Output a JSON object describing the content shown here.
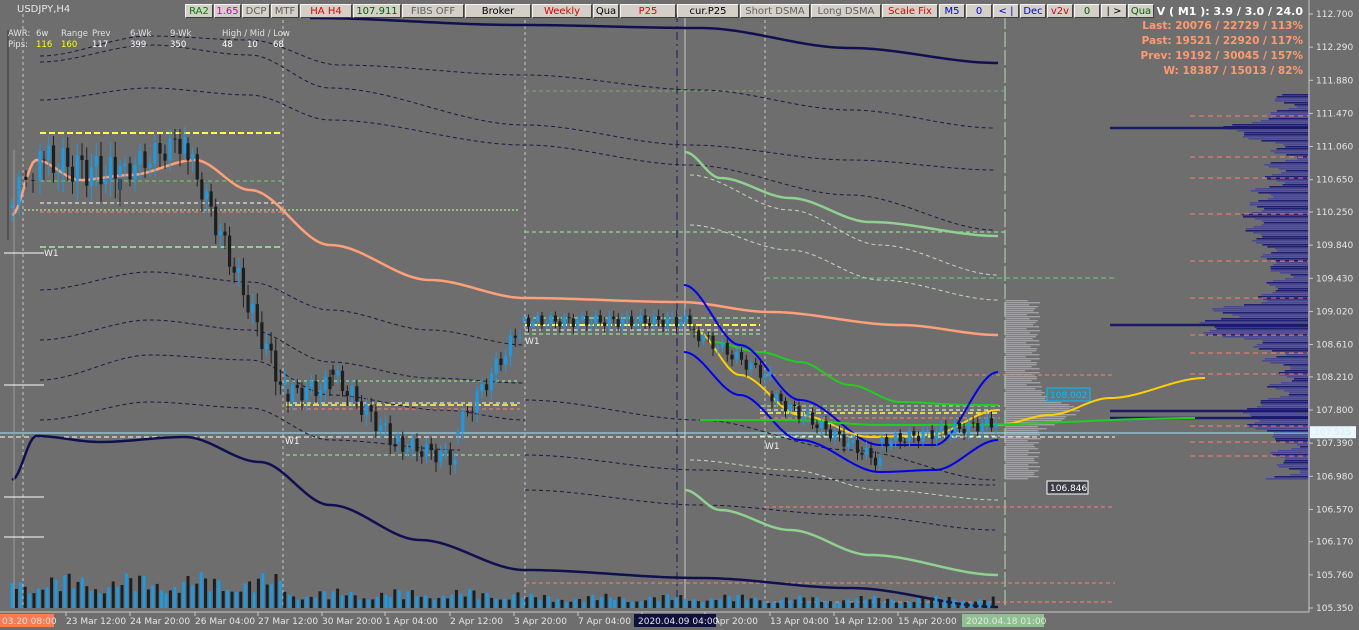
{
  "symbol": "USDJPY,H4",
  "toolbar": [
    {
      "label": "RA2",
      "color": "#008000",
      "w": 28
    },
    {
      "label": "1.65",
      "color": "#c000c0",
      "w": 27
    },
    {
      "label": "DCP",
      "color": "#606060",
      "w": 28
    },
    {
      "label": "MTF",
      "color": "#606060",
      "w": 28
    },
    {
      "label": "HA H4",
      "color": "#e00000",
      "w": 52
    },
    {
      "label": "107.911",
      "color": "#006000",
      "w": 48
    },
    {
      "label": "FIBS OFF",
      "color": "#606060",
      "w": 62
    },
    {
      "label": "Broker",
      "color": "#000000",
      "w": 66
    },
    {
      "label": "Weekly",
      "color": "#e00000",
      "w": 60
    },
    {
      "label": "Qua",
      "color": "#000000",
      "w": 26
    },
    {
      "label": "P25",
      "color": "#e00000",
      "w": 56
    },
    {
      "label": "cur.P25",
      "color": "#000000",
      "w": 62
    },
    {
      "label": "Short DSMA",
      "color": "#606060",
      "w": 70
    },
    {
      "label": "Long DSMA",
      "color": "#606060",
      "w": 70
    },
    {
      "label": "Scale Fix",
      "color": "#e00000",
      "w": 56
    },
    {
      "label": "M5",
      "color": "#0000e0",
      "w": 26
    },
    {
      "label": "0",
      "color": "#0000e0",
      "w": 26
    },
    {
      "label": "< |",
      "color": "#0000e0",
      "w": 26
    },
    {
      "label": "Dec",
      "color": "#0000e0",
      "w": 26
    },
    {
      "label": "v2v",
      "color": "#e00000",
      "w": 26
    },
    {
      "label": "0",
      "color": "#006000",
      "w": 26
    },
    {
      "label": "| >",
      "color": "#000000",
      "w": 26
    },
    {
      "label": "Qua",
      "color": "#006000",
      "w": 26
    }
  ],
  "stats": [
    {
      "text": "V ( M1 ): 3.9 / 3.0 / 24.0",
      "color": "#ffffff"
    },
    {
      "text": "Last: 20076 / 22729 / 113%",
      "color": "#ff9a70"
    },
    {
      "text": "Past: 19521 / 22920 / 117%",
      "color": "#ff9a70"
    },
    {
      "text": "Prev: 19192 / 30045 / 157%",
      "color": "#ff9a70"
    },
    {
      "text": "W: 18387 / 15013 / 82%",
      "color": "#ff9a70"
    }
  ],
  "header_labels": [
    "AWR:",
    "6w",
    "Range",
    "Prev",
    "6-Wk",
    "9-Wk",
    "High / Mid / Low"
  ],
  "header_row2_label": "Pips:",
  "header_values": [
    {
      "text": "116",
      "color": "#ffff00"
    },
    {
      "text": "160",
      "color": "#ffff00"
    },
    {
      "text": "117",
      "color": "#ffffff"
    },
    {
      "text": "399",
      "color": "#ffffff"
    },
    {
      "text": "350",
      "color": "#ffffff"
    },
    {
      "text": "48",
      "color": "#ffffff"
    },
    {
      "text": "10",
      "color": "#ffffff"
    },
    {
      "text": "68",
      "color": "#ffffff"
    }
  ],
  "price_ticks": [
    "112.700",
    "112.290",
    "111.880",
    "111.470",
    "111.060",
    "110.650",
    "110.250",
    "109.840",
    "109.430",
    "109.020",
    "108.610",
    "108.210",
    "107.800",
    "107.390",
    "106.980",
    "106.570",
    "106.170",
    "105.760",
    "105.350"
  ],
  "current_price": "107.525",
  "time_ticks": [
    "23 Mar 12:00",
    "24 Mar 20:00",
    "26 Mar 04:00",
    "27 Mar 12:00",
    "30 Mar 20:00",
    "1 Apr 04:00",
    "2 Apr 12:00",
    "3 Apr 20:00",
    "7 Apr 04:00",
    "8 Apr 12:00",
    "9 Apr 20:00",
    "13 Apr 04:00",
    "14 Apr 12:00",
    "15 Apr 20:00"
  ],
  "time_start_label": "03.20 08:00",
  "time_cursor_label": "2020.04.09 04:00",
  "time_end_label": "2020.04.18 01:00",
  "w1_label": "W1",
  "price_tags": [
    {
      "text": "108.002",
      "color": "#00c0ff"
    },
    {
      "text": "106.846",
      "color": "#ffffff"
    }
  ],
  "colors": {
    "background": "#6e6e6e",
    "bull": "#1a9be6",
    "bear": "#1e1e1e",
    "ma_salmon": "#ffa07a",
    "envelope_navy": "#101050",
    "regression_blue": "#0000ee",
    "regression_yellow": "#ffd000",
    "green_ma": "#22cc22",
    "light_green": "#90d090"
  }
}
